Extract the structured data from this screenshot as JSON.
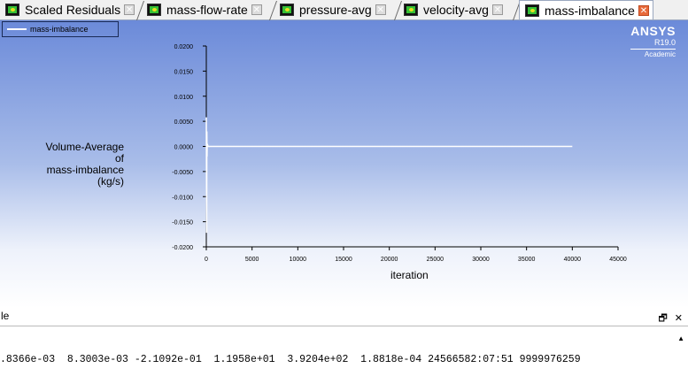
{
  "tabs": [
    {
      "label": "Scaled Residuals",
      "active": false
    },
    {
      "label": "mass-flow-rate",
      "active": false
    },
    {
      "label": "pressure-avg",
      "active": false
    },
    {
      "label": "velocity-avg",
      "active": false
    },
    {
      "label": "mass-imbalance",
      "active": true
    }
  ],
  "brand": {
    "name": "ANSYS",
    "release": "R19.0",
    "edition": "Academic"
  },
  "legend": {
    "label": "mass-imbalance"
  },
  "chart_data": {
    "type": "line",
    "ylabel": [
      "Volume-Average",
      "of",
      "mass-imbalance",
      "(kg/s)"
    ],
    "xlabel": "iteration",
    "xlim": [
      0,
      45000
    ],
    "ylim": [
      -0.02,
      0.02
    ],
    "xticks": [
      "0",
      "5000",
      "10000",
      "15000",
      "20000",
      "25000",
      "30000",
      "35000",
      "40000",
      "45000"
    ],
    "yticks": [
      "0.0200",
      "0.0150",
      "0.0100",
      "0.0050",
      "0.0000",
      "-0.0050",
      "-0.0100",
      "-0.0150",
      "-0.0200"
    ],
    "series": [
      {
        "name": "mass-imbalance",
        "color": "#ffffff",
        "x": [
          0,
          40,
          60,
          80,
          100,
          200,
          500,
          1000,
          5000,
          10000,
          15000,
          20000,
          25000,
          30000,
          35000,
          40000
        ],
        "y": [
          0.0058,
          -0.0172,
          0.003,
          -0.002,
          0.0005,
          0,
          0,
          0,
          0,
          0,
          0,
          0,
          0,
          0,
          0,
          0
        ]
      }
    ]
  },
  "console": {
    "title": "le",
    "line": ".8366e-03  8.3003e-03 -2.1092e-01  1.1958e+01  3.9204e+02  1.8818e-04 24566582:07:51 9999976259"
  }
}
